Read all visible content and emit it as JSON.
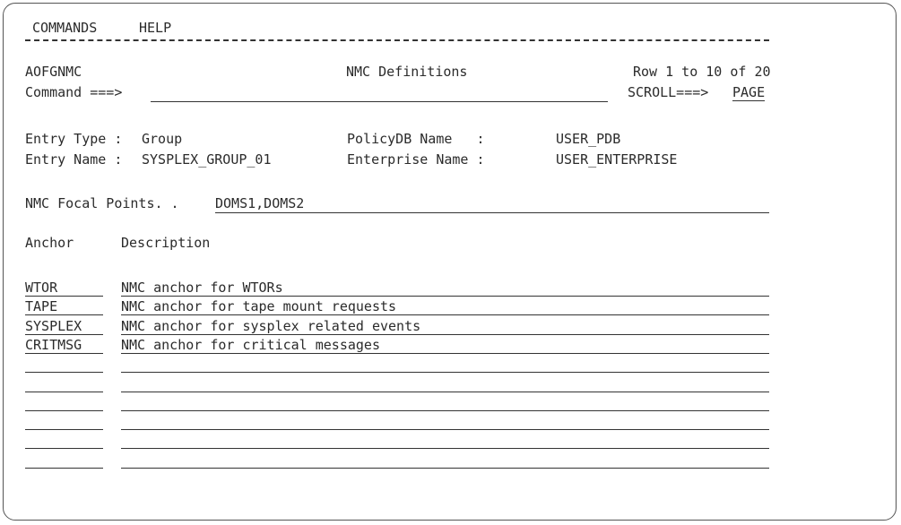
{
  "menu": {
    "commands": "COMMANDS",
    "help": "HELP"
  },
  "header": {
    "panel_id": "AOFGNMC",
    "title": "NMC Definitions",
    "row_info": "Row 1 to 10 of 20",
    "command_label": "Command ===>",
    "command_value": "",
    "scroll_label": "SCROLL===>",
    "scroll_value": "PAGE"
  },
  "entry": {
    "type_label": "Entry Type :",
    "type_value": "Group",
    "name_label": "Entry Name :",
    "name_value": "SYSPLEX_GROUP_01",
    "policydb_label": "PolicyDB Name   :",
    "policydb_value": "USER_PDB",
    "enterprise_label": "Enterprise Name :",
    "enterprise_value": "USER_ENTERPRISE"
  },
  "focal": {
    "label": "NMC Focal Points. .",
    "value": "DOMS1,DOMS2"
  },
  "table": {
    "col_anchor": "Anchor",
    "col_description": "Description",
    "rows": [
      {
        "anchor": "WTOR",
        "description": "NMC anchor for WTORs"
      },
      {
        "anchor": "TAPE",
        "description": "NMC anchor for tape mount requests"
      },
      {
        "anchor": "SYSPLEX",
        "description": "NMC anchor for sysplex related events"
      },
      {
        "anchor": "CRITMSG",
        "description": "NMC anchor for critical messages"
      },
      {
        "anchor": "",
        "description": ""
      },
      {
        "anchor": "",
        "description": ""
      },
      {
        "anchor": "",
        "description": ""
      },
      {
        "anchor": "",
        "description": ""
      },
      {
        "anchor": "",
        "description": ""
      },
      {
        "anchor": "",
        "description": ""
      }
    ]
  }
}
